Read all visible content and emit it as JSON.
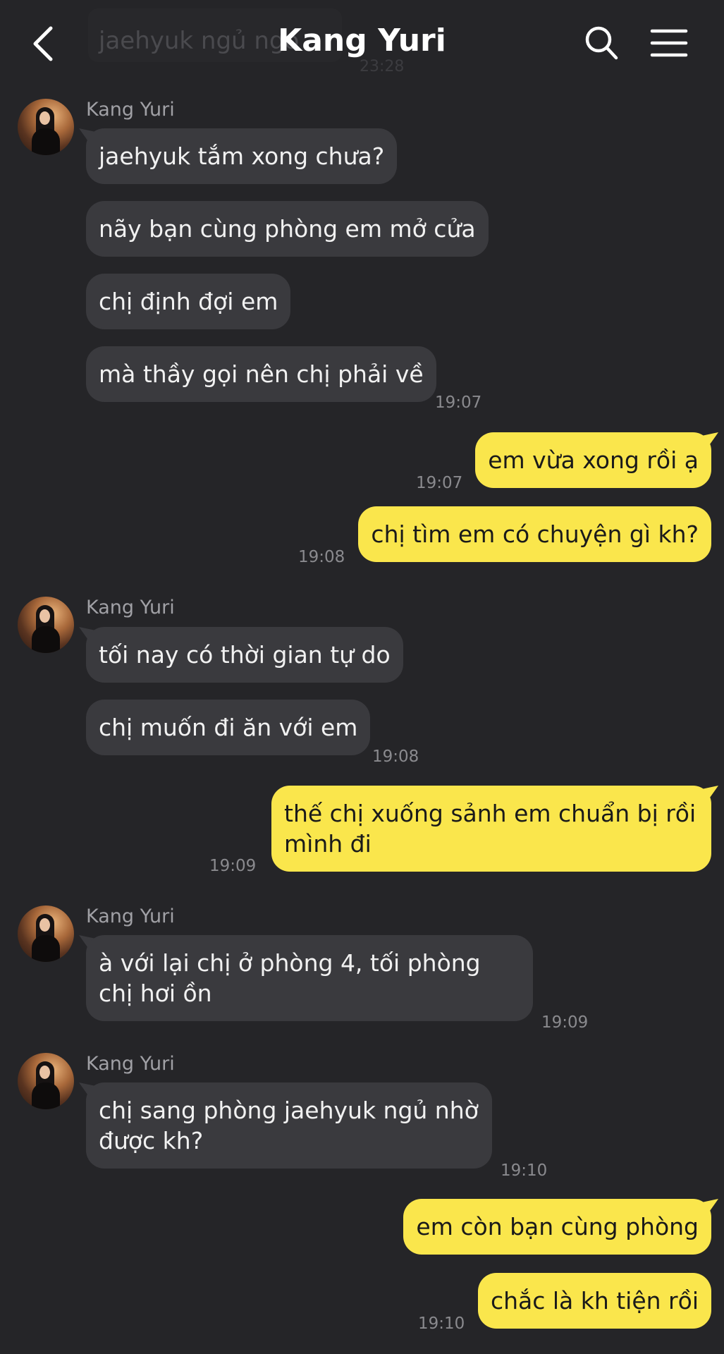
{
  "header": {
    "title": "Kang Yuri",
    "behind_preview": "jaehyuk ngủ ngo",
    "behind_time": "23:28",
    "back_icon": "chevron-left-icon",
    "search_icon": "search-icon",
    "menu_icon": "hamburger-menu-icon"
  },
  "colors": {
    "background": "#252528",
    "incoming_bubble": "#3a3a3e",
    "outgoing_bubble": "#fae64c"
  },
  "messages": [
    {
      "sender": "Kang Yuri",
      "direction": "in",
      "text": "jaehyuk tắm xong chưa?"
    },
    {
      "direction": "in",
      "text": "nãy bạn cùng phòng em mở cửa"
    },
    {
      "direction": "in",
      "text": "chị định đợi em"
    },
    {
      "direction": "in",
      "text": "mà thầy gọi nên chị phải về",
      "time": "19:07"
    },
    {
      "direction": "out",
      "text": "em vừa xong rồi ạ",
      "time": "19:07"
    },
    {
      "direction": "out",
      "text": "chị tìm em có chuyện gì kh?",
      "time": "19:08"
    },
    {
      "sender": "Kang Yuri",
      "direction": "in",
      "text": "tối nay có thời gian tự do"
    },
    {
      "direction": "in",
      "text": "chị muốn đi ăn với em",
      "time": "19:08"
    },
    {
      "direction": "out",
      "text": "thế chị xuống sảnh em chuẩn bị rồi mình đi",
      "time": "19:09"
    },
    {
      "sender": "Kang Yuri",
      "direction": "in",
      "text": "à với lại chị ở phòng 4, tối phòng chị hơi ồn",
      "time": "19:09"
    },
    {
      "sender": "Kang Yuri",
      "direction": "in",
      "text": "chị sang phòng jaehyuk ngủ nhờ được kh?",
      "time": "19:10"
    },
    {
      "direction": "out",
      "text": "em còn bạn cùng phòng"
    },
    {
      "direction": "out",
      "text": "chắc là kh tiện rồi",
      "time": "19:10"
    }
  ]
}
